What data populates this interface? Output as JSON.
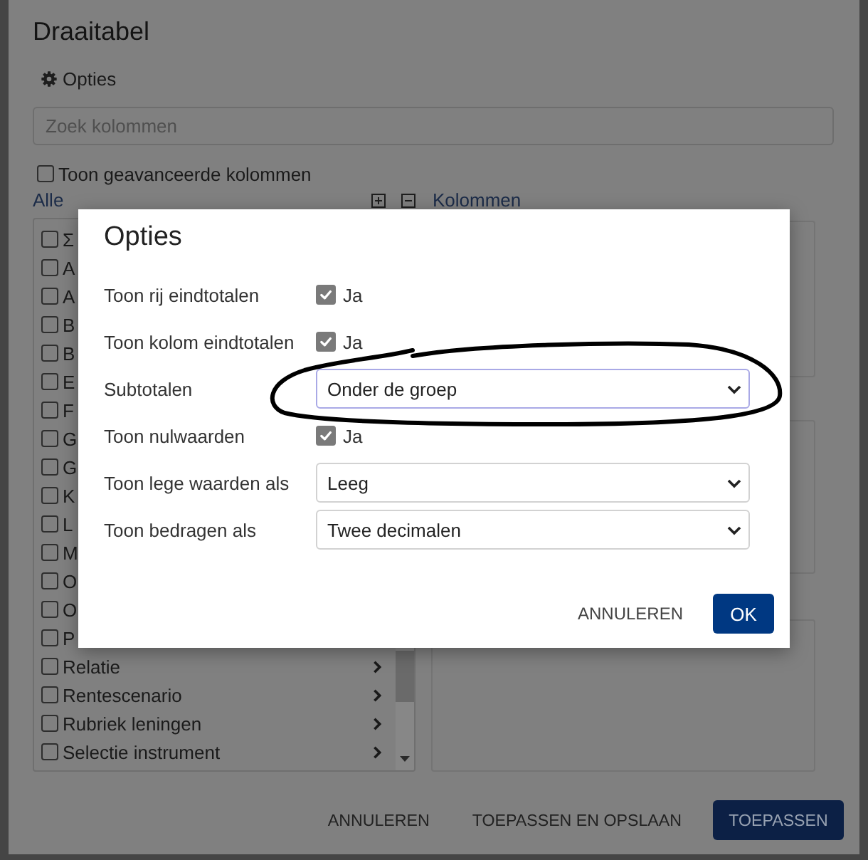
{
  "background_dialog": {
    "title": "Draaitabel",
    "options_button": "Opties",
    "search": {
      "placeholder": "Zoek kolommen"
    },
    "advanced_columns": {
      "label": "Toon geavanceerde kolommen",
      "checked": false
    },
    "all_list": {
      "heading": "Alle",
      "items": [
        {
          "kind": "partial",
          "label": "Σ",
          "checked": false
        },
        {
          "kind": "partial",
          "label": "A",
          "checked": false
        },
        {
          "kind": "partial",
          "label": "A",
          "checked": false
        },
        {
          "kind": "partial",
          "label": "B",
          "checked": false
        },
        {
          "kind": "partial",
          "label": "B",
          "checked": false
        },
        {
          "kind": "partial",
          "label": "E",
          "checked": false
        },
        {
          "kind": "partial",
          "label": "F",
          "checked": false
        },
        {
          "kind": "partial",
          "label": "G",
          "checked": false
        },
        {
          "kind": "partial",
          "label": "G",
          "checked": false
        },
        {
          "kind": "partial",
          "label": "K",
          "checked": false
        },
        {
          "kind": "partial",
          "label": "L",
          "checked": false
        },
        {
          "kind": "partial",
          "label": "M",
          "checked": false
        },
        {
          "kind": "partial",
          "label": "O",
          "checked": false
        },
        {
          "kind": "partial",
          "label": "O",
          "checked": false
        },
        {
          "kind": "partial",
          "label": "P",
          "checked": false
        },
        {
          "kind": "full",
          "label": "Relatie",
          "checked": false
        },
        {
          "kind": "full",
          "label": "Rentescenario",
          "checked": false
        },
        {
          "kind": "full",
          "label": "Rubriek leningen",
          "checked": false
        },
        {
          "kind": "full",
          "label": "Selectie instrument",
          "checked": false
        }
      ]
    },
    "columns_panel": {
      "heading": "Kolommen"
    },
    "buttons": [
      {
        "label": "ANNULEREN",
        "kind": "text"
      },
      {
        "label": "TOEPASSEN EN OPSLAAN",
        "kind": "text"
      },
      {
        "label": "TOEPASSEN",
        "kind": "primary"
      }
    ]
  },
  "options_dialog": {
    "title": "Opties",
    "rows": [
      {
        "kind": "checkbox",
        "label": "Toon rij eindtotalen",
        "checked": true,
        "text": "Ja",
        "circled": false
      },
      {
        "kind": "checkbox",
        "label": "Toon kolom eindtotalen",
        "checked": true,
        "text": "Ja",
        "circled": false
      },
      {
        "kind": "select",
        "label": "Subtotalen",
        "value": "Onder de groep",
        "focused": true,
        "circled": true
      },
      {
        "kind": "checkbox",
        "label": "Toon nulwaarden",
        "checked": true,
        "text": "Ja",
        "circled": false
      },
      {
        "kind": "select",
        "label": "Toon lege waarden als",
        "value": "Leeg",
        "focused": false,
        "circled": false
      },
      {
        "kind": "select",
        "label": "Toon bedragen als",
        "value": "Twee decimalen",
        "focused": false,
        "circled": false
      }
    ],
    "buttons": [
      {
        "label": "ANNULEREN",
        "kind": "text"
      },
      {
        "label": "OK",
        "kind": "primary"
      }
    ]
  }
}
